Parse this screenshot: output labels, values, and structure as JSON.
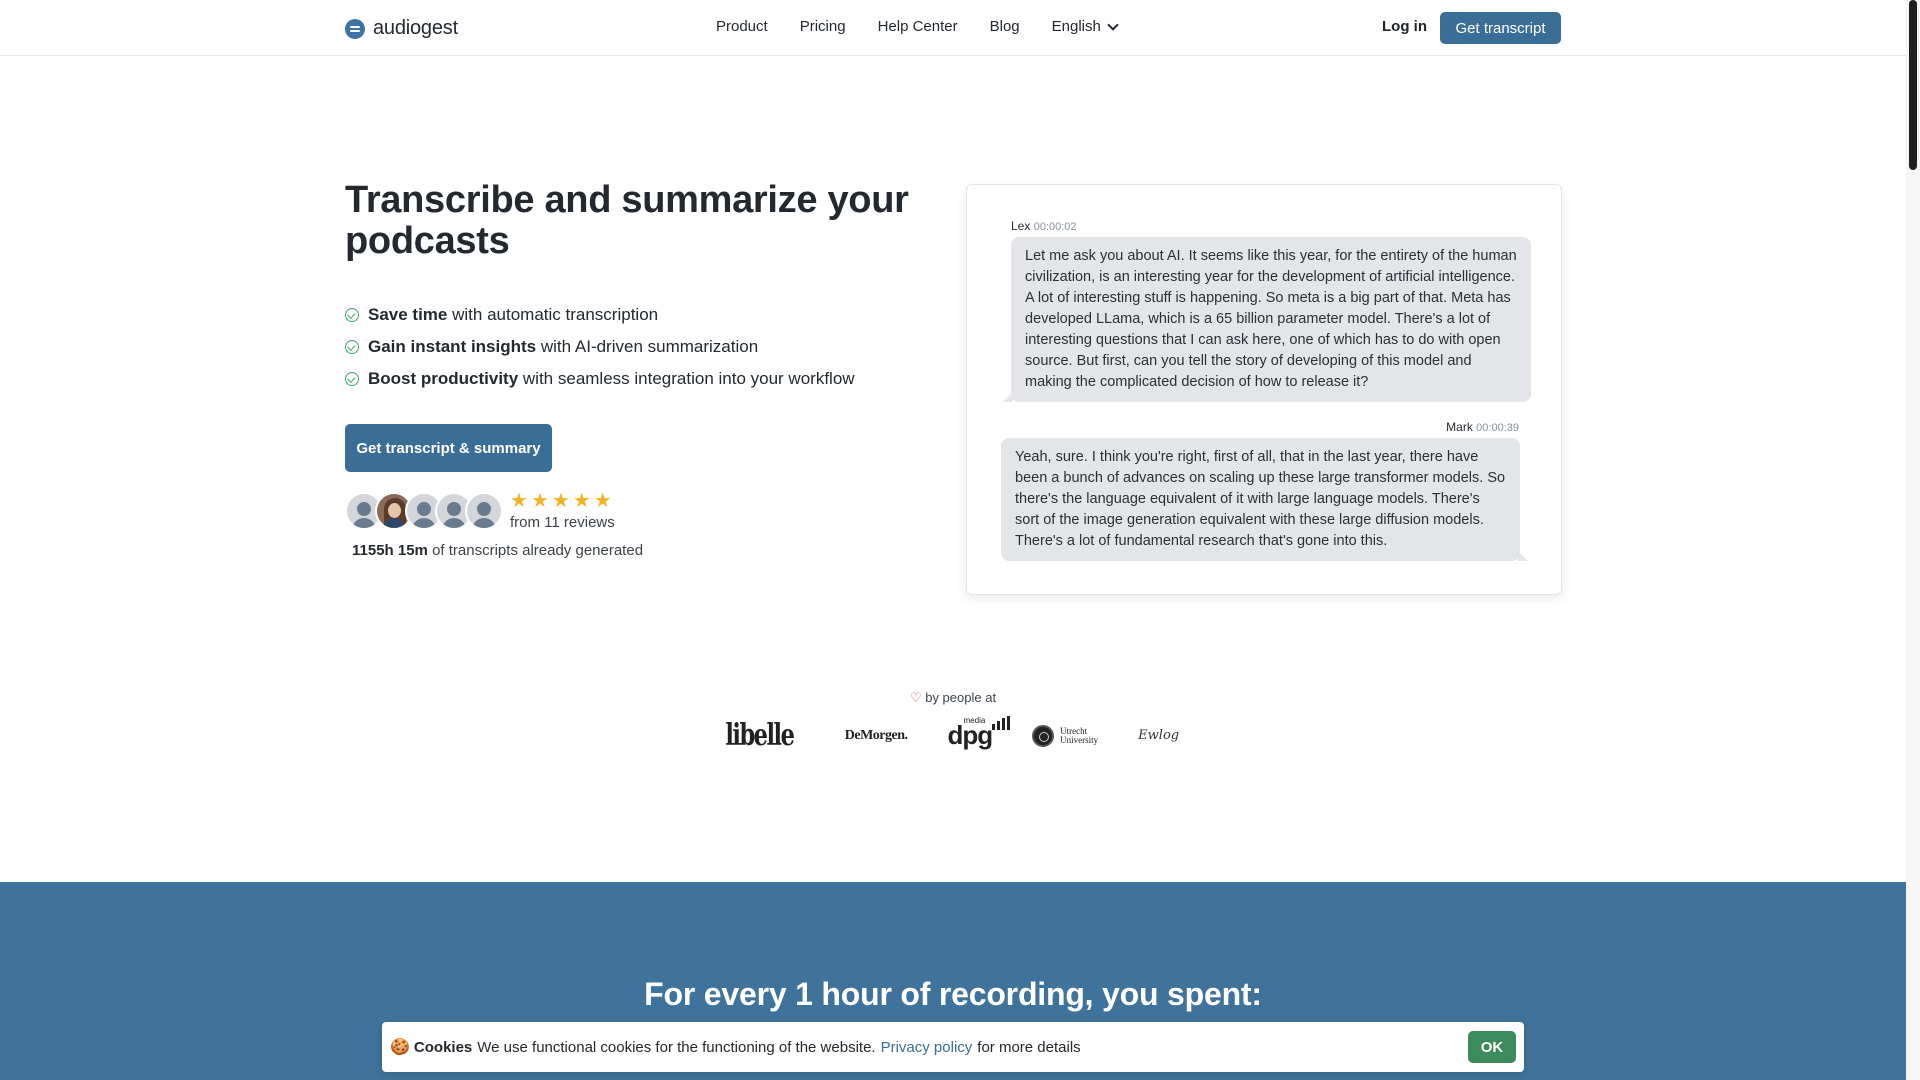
{
  "nav": {
    "logo_text": "audiogest",
    "links": [
      "Product",
      "Pricing",
      "Help Center",
      "Blog"
    ],
    "language": "English",
    "login": "Log in",
    "cta": "Get transcript"
  },
  "hero": {
    "title": "Transcribe and summarize your podcasts",
    "bullets": [
      {
        "bold": "Save time",
        "rest": "with automatic transcription"
      },
      {
        "bold": "Gain instant insights",
        "rest": "with AI-driven summarization"
      },
      {
        "bold": "Boost productivity",
        "rest": "with seamless integration into your workflow"
      }
    ],
    "cta": "Get transcript & summary",
    "rating_stars": 5,
    "reviews": "from 11 reviews",
    "generated_hours": "1155h 15m",
    "generated_rest": "of transcripts already generated"
  },
  "chat": [
    {
      "speaker": "Lex",
      "time": "00:00:02",
      "text": "Let me ask you about AI. It seems like this year, for the entirety of the human civilization, is an interesting year for the development of artificial intelligence. A lot of interesting stuff is happening. So meta is a big part of that. Meta has developed LLama, which is a 65 billion parameter model. There's a lot of interesting questions that I can ask here, one of which has to do with open source. But first, can you tell the story of developing of this model and making the complicated decision of how to release it?"
    },
    {
      "speaker": "Mark",
      "time": "00:00:39",
      "text": "Yeah, sure. I think you're right, first of all, that in the last year, there have been a bunch of advances on scaling up these large transformer models. So there's the language equivalent of it with large language models. There's sort of the image generation equivalent with these large diffusion models. There's a lot of fundamental research that's gone into this."
    }
  ],
  "loved_by": {
    "text": "by people at",
    "logos": [
      "libelle",
      "DeMorgen.",
      "dpg",
      "media",
      "Utrecht",
      "University",
      "Ewlog"
    ]
  },
  "section": {
    "title": "For every 1 hour of recording, you spent:"
  },
  "cookie": {
    "icon": "🍪",
    "title": "Cookies",
    "text": "We use functional cookies for the functioning of the website.",
    "link": "Privacy policy",
    "rest": "for more details",
    "ok": "OK"
  },
  "colors": {
    "primary": "#3b6e97",
    "section_bg": "#40739b",
    "ok_button": "#3d8b5c",
    "check": "#3aa66a",
    "star": "#f0b429"
  }
}
